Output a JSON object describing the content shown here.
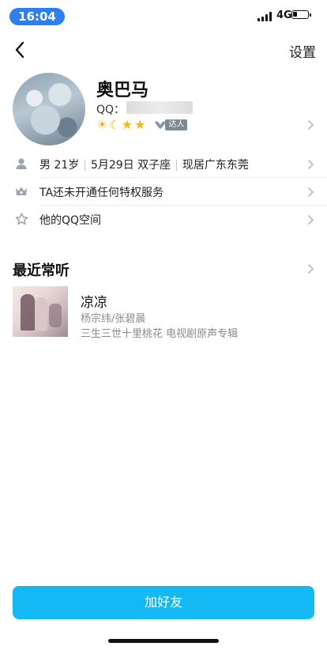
{
  "status_bar": {
    "time": "16:04",
    "network": "4G"
  },
  "nav": {
    "settings_label": "设置"
  },
  "profile": {
    "name": "奥巴马",
    "qq_label": "QQ：",
    "talent_tag": "达人"
  },
  "info_rows": [
    {
      "icon": "person-icon",
      "parts": [
        "男 21岁",
        "5月29日 双子座",
        "现居广东东莞"
      ]
    },
    {
      "icon": "crown-icon",
      "text": "TA还未开通任何特权服务"
    },
    {
      "icon": "star-outline-icon",
      "text": "他的QQ空间"
    }
  ],
  "recent": {
    "title": "最近常听",
    "song": {
      "title": "凉凉",
      "artist": "杨宗纬/张碧晨",
      "album": "三生三世十里桃花 电视剧原声专辑"
    }
  },
  "actions": {
    "add_friend": "加好友"
  },
  "colors": {
    "accent": "#14b8f2",
    "time_pill": "#2f7ef0",
    "badge": "#f3b81f"
  }
}
